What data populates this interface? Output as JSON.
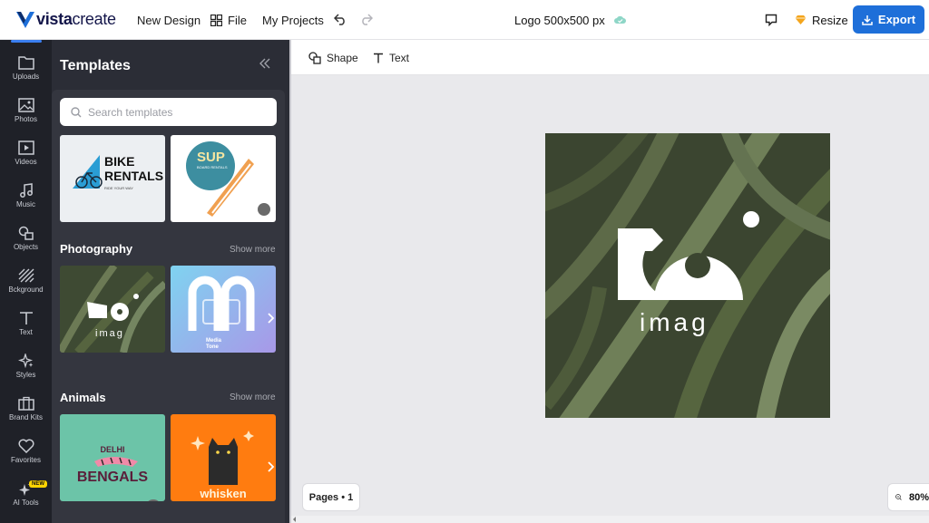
{
  "brand": {
    "name_bold": "vista",
    "name_rest": "create",
    "accent": "#1e6fd9"
  },
  "topnav": {
    "new_design": "New Design",
    "file": "File",
    "my_projects": "My Projects"
  },
  "document": {
    "title": "Logo 500x500 px"
  },
  "actions": {
    "resize": "Resize",
    "export": "Export"
  },
  "rail": [
    {
      "label": "Uploads",
      "icon": "folder-icon"
    },
    {
      "label": "Photos",
      "icon": "photo-icon"
    },
    {
      "label": "Videos",
      "icon": "video-icon"
    },
    {
      "label": "Music",
      "icon": "music-icon"
    },
    {
      "label": "Objects",
      "icon": "objects-icon"
    },
    {
      "label": "Bckground",
      "icon": "background-icon"
    },
    {
      "label": "Text",
      "icon": "text-icon"
    },
    {
      "label": "Styles",
      "icon": "sparkle-icon"
    },
    {
      "label": "Brand Kits",
      "icon": "briefcase-icon"
    },
    {
      "label": "Favorites",
      "icon": "heart-icon"
    },
    {
      "label": "AI Tools",
      "icon": "ai-sparkle-icon",
      "badge": "NEW"
    }
  ],
  "panel": {
    "title": "Templates",
    "search_placeholder": "Search templates",
    "sections": [
      {
        "label": "",
        "templates": [
          {
            "line1": "BIKE",
            "line2": "RENTALS",
            "sub": "RIDE YOUR WAY"
          },
          {
            "line1": "SUP",
            "line2": "BOARD RENTALS"
          }
        ]
      },
      {
        "label": "Photography",
        "show_more": "Show more",
        "templates": [
          {
            "line1": "imag"
          },
          {
            "line1": "Media",
            "line2": "Tone"
          }
        ]
      },
      {
        "label": "Animals",
        "show_more": "Show more",
        "templates": [
          {
            "line1": "DELHI",
            "line2": "BENGALS"
          },
          {
            "line1": "whisken"
          }
        ]
      }
    ]
  },
  "toolbar": {
    "shape": "Shape",
    "text": "Text"
  },
  "canvas": {
    "logo_text": "imag"
  },
  "footer": {
    "pages": "Pages • 1",
    "zoom": "80%"
  }
}
